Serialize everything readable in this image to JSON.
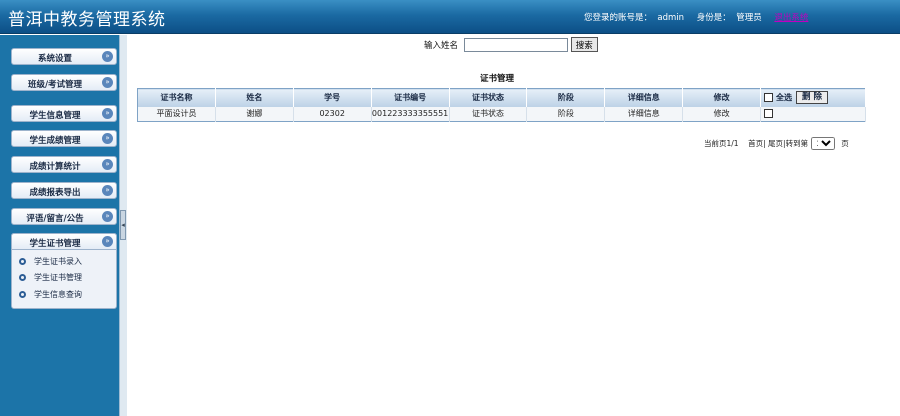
{
  "header": {
    "title": "普洱中教务管理系统",
    "user_label": "您登录的账号是：",
    "username": "admin",
    "role_label": "身份是：",
    "role": "管理员",
    "logout": "退出系统"
  },
  "sidebar": {
    "menus": [
      {
        "label": "系统设置"
      },
      {
        "label": "班级/考试管理"
      },
      {
        "label": "学生信息管理"
      },
      {
        "label": "学生成绩管理"
      },
      {
        "label": "成绩计算统计"
      },
      {
        "label": "成绩报表导出"
      },
      {
        "label": "评语/留言/公告"
      }
    ],
    "expanded": {
      "label": "学生证书管理",
      "items": [
        {
          "label": "学生证书录入"
        },
        {
          "label": "学生证书管理"
        },
        {
          "label": "学生信息查询"
        }
      ]
    }
  },
  "search": {
    "label": "输入姓名",
    "value": "",
    "button": "搜索"
  },
  "section_title": "证书管理",
  "table": {
    "headers": [
      "证书名称",
      "姓名",
      "学号",
      "证书编号",
      "证书状态",
      "阶段",
      "详细信息",
      "修改"
    ],
    "select_all": "全选",
    "delete_button": "删 除",
    "rows": [
      [
        "平面设计员",
        "谢娜",
        "02302",
        "001223333355551",
        "证书状态",
        "阶段",
        "详细信息",
        "修改"
      ]
    ]
  },
  "pager": {
    "current": "当前页1/1",
    "first": "首页",
    "last": "尾页",
    "goto": "转到第",
    "page_value": "1",
    "page_unit": "页"
  }
}
